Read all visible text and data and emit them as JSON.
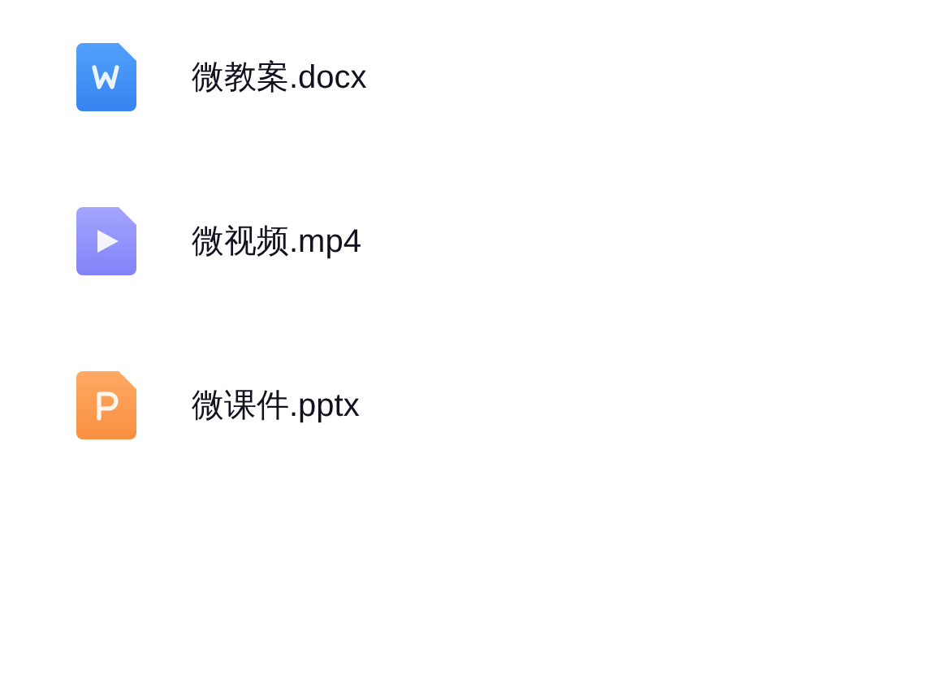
{
  "files": [
    {
      "kind": "word",
      "name": "微教案.docx"
    },
    {
      "kind": "video",
      "name": "微视频.mp4"
    },
    {
      "kind": "slides",
      "name": "微课件.pptx"
    }
  ]
}
